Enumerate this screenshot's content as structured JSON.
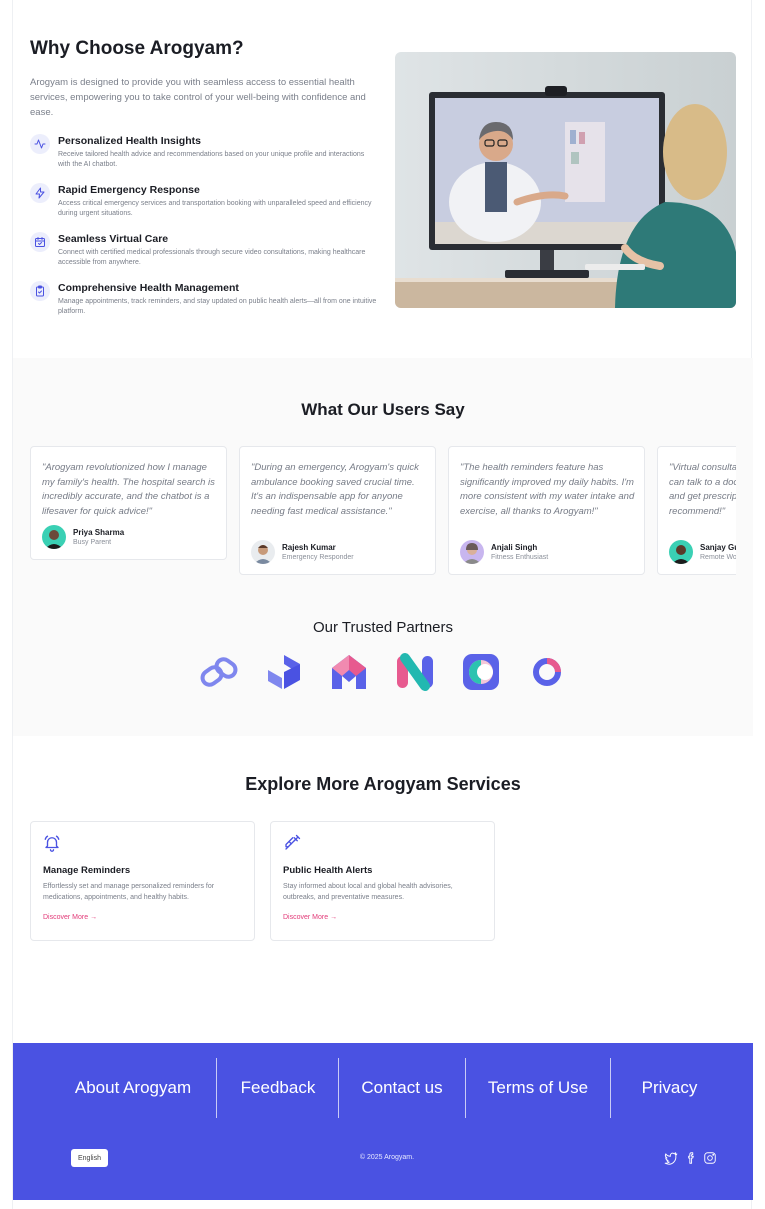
{
  "why": {
    "title": "Why Choose Arogyam?",
    "intro": "Arogyam is designed to provide you with seamless access to essential health services, empowering you to take control of your well-being with confidence and ease.",
    "features": [
      {
        "icon": "activity-icon",
        "title": "Personalized Health Insights",
        "desc": "Receive tailored health advice and recommendations based on your unique profile and interactions with the AI chatbot."
      },
      {
        "icon": "lightning-icon",
        "title": "Rapid Emergency Response",
        "desc": "Access critical emergency services and transportation booking with unparalleled speed and efficiency during urgent situations."
      },
      {
        "icon": "calendar-check-icon",
        "title": "Seamless Virtual Care",
        "desc": "Connect with certified medical professionals through secure video consultations, making healthcare accessible from anywhere."
      },
      {
        "icon": "clipboard-check-icon",
        "title": "Comprehensive Health Management",
        "desc": "Manage appointments, track reminders, and stay updated on public health alerts—all from one intuitive platform."
      }
    ]
  },
  "testimonials": {
    "title": "What Our Users Say",
    "items": [
      {
        "quote": "\"Arogyam revolutionized how I manage my family's health. The hospital search is incredibly accurate, and the chatbot is a lifesaver for quick advice!\"",
        "name": "Priya Sharma",
        "role": "Busy Parent"
      },
      {
        "quote": "\"During an emergency, Arogyam's quick ambulance booking saved crucial time. It's an indispensable app for anyone needing fast medical assistance.\"",
        "name": "Rajesh Kumar",
        "role": "Emergency Responder"
      },
      {
        "quote": "\"The health reminders feature has significantly improved my daily habits. I'm more consistent with my water intake and exercise, all thanks to Arogyam!\"",
        "name": "Anjali Singh",
        "role": "Fitness Enthusiast"
      },
      {
        "quote": "\"Virtual consultations are so convenient. I can talk to a doctor without leaving home and get prescriptions delivered. Highly recommend!\"",
        "name": "Sanjay Gupta",
        "role": "Remote Worker"
      }
    ]
  },
  "partners": {
    "title": "Our Trusted Partners",
    "logos": [
      "link-logo",
      "arrow-cube-logo",
      "house-logo",
      "ribbon-logo",
      "square-ring-logo",
      "ring-logo"
    ]
  },
  "services": {
    "title": "Explore More Arogyam Services",
    "items": [
      {
        "icon": "bell-icon",
        "title": "Manage Reminders",
        "desc": "Effortlessly set and manage personalized reminders for medications, appointments, and healthy habits.",
        "link": "Discover More →"
      },
      {
        "icon": "syringe-icon",
        "title": "Public Health Alerts",
        "desc": "Stay informed about local and global health advisories, outbreaks, and preventative measures.",
        "link": "Discover More →"
      }
    ]
  },
  "footer": {
    "nav": [
      "About Arogyam",
      "Feedback",
      "Contact us",
      "Terms of Use",
      "Privacy"
    ],
    "language": "English",
    "copyright": "© 2025 Arogyam.",
    "social": [
      "twitter-icon",
      "facebook-icon",
      "instagram-icon"
    ]
  },
  "colors": {
    "brand": "#4a52e2",
    "accent_link": "#e23a78",
    "icon_bg": "#eceefc"
  }
}
